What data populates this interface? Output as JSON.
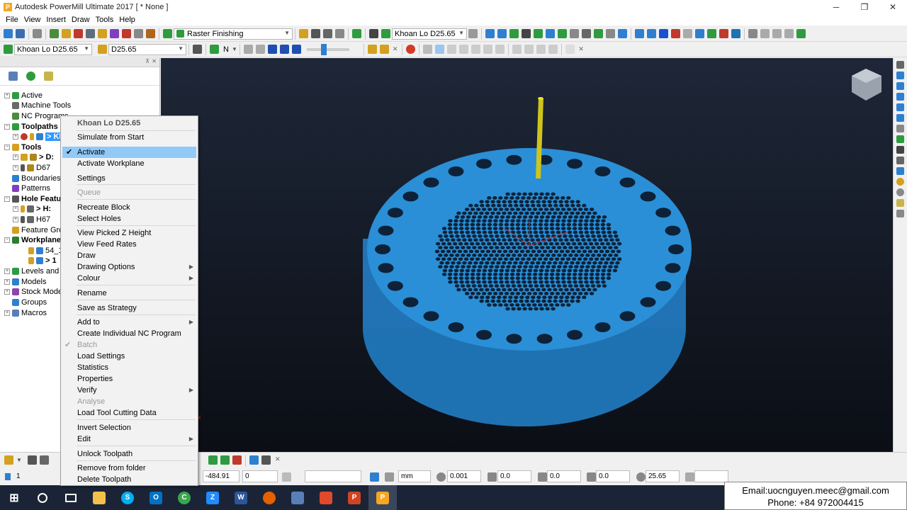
{
  "window": {
    "title": "Autodesk PowerMill Ultimate 2017   [ * None ]",
    "controls": [
      "─",
      "❐",
      "✕"
    ]
  },
  "menubar": [
    "File",
    "View",
    "Insert",
    "Draw",
    "Tools",
    "Help"
  ],
  "toolbar1": {
    "strategy": "Raster Finishing",
    "toolpath": "Khoan Lo D25.65"
  },
  "toolbar2": {
    "toolpath": "Khoan Lo D25.65",
    "tool": "D25.65",
    "workplane": "N"
  },
  "tree": {
    "items": [
      {
        "label": "Active",
        "bold": false
      },
      {
        "label": "Machine Tools",
        "bold": false
      },
      {
        "label": "NC Programs",
        "bold": false
      },
      {
        "label": "Toolpaths",
        "bold": true
      },
      {
        "label": "> Kl",
        "bold": true
      },
      {
        "label": "Tools",
        "bold": true
      },
      {
        "label": "> D:",
        "bold": true
      },
      {
        "label": "D67",
        "bold": false
      },
      {
        "label": "Boundaries",
        "bold": false
      },
      {
        "label": "Patterns",
        "bold": false
      },
      {
        "label": "Hole Featur",
        "bold": true
      },
      {
        "label": "> H:",
        "bold": true
      },
      {
        "label": "H67",
        "bold": false
      },
      {
        "label": "Feature Grou",
        "bold": false
      },
      {
        "label": "Workplanes",
        "bold": true
      },
      {
        "label": "54_1",
        "bold": false
      },
      {
        "label": "> 1",
        "bold": true
      },
      {
        "label": "Levels and S",
        "bold": false
      },
      {
        "label": "Models",
        "bold": false
      },
      {
        "label": "Stock Mode",
        "bold": false
      },
      {
        "label": "Groups",
        "bold": false
      },
      {
        "label": "Macros",
        "bold": false
      }
    ]
  },
  "context_menu": {
    "header": "Khoan Lo D25.65",
    "items": [
      {
        "label": "Simulate from Start"
      },
      {
        "label": "Activate",
        "checked": true,
        "highlighted": true
      },
      {
        "label": "Activate Workplane"
      },
      {
        "label": "Settings"
      },
      {
        "label": "Queue",
        "disabled": true
      },
      {
        "label": "Recreate Block"
      },
      {
        "label": "Select Holes"
      },
      {
        "label": "View Picked Z Height"
      },
      {
        "label": "View Feed Rates"
      },
      {
        "label": "Draw"
      },
      {
        "label": "Drawing Options",
        "submenu": true
      },
      {
        "label": "Colour",
        "submenu": true
      },
      {
        "label": "Rename"
      },
      {
        "label": "Save as Strategy"
      },
      {
        "label": "Add to",
        "submenu": true
      },
      {
        "label": "Create Individual NC Program"
      },
      {
        "label": "Batch",
        "disabled": true,
        "checked_dim": true
      },
      {
        "label": "Load Settings"
      },
      {
        "label": "Statistics"
      },
      {
        "label": "Properties"
      },
      {
        "label": "Verify",
        "submenu": true
      },
      {
        "label": "Analyse",
        "disabled": true
      },
      {
        "label": "Load Tool Cutting Data"
      },
      {
        "label": "Invert Selection"
      },
      {
        "label": "Edit",
        "submenu": true
      },
      {
        "label": "Unlock Toolpath"
      },
      {
        "label": "Remove from folder"
      },
      {
        "label": "Delete Toolpath"
      }
    ]
  },
  "statusbar": {
    "left_value": "1",
    "x": "-484.91",
    "y": "0",
    "units": "mm",
    "tolerance": "0.001",
    "thickness": "0.0",
    "stepover": "0.0",
    "other": "0.0",
    "diameter": "25.65"
  },
  "contact": {
    "email": "Email:uocnguyen.meec@gmail.com",
    "phone": "Phone: +84 972004415"
  },
  "colors": {
    "part": "#2a8fd6",
    "part_dark": "#1f72b2",
    "tool": "#cfc41a",
    "viewport_top": "#1e2738",
    "highlight": "#91c9f7"
  },
  "taskbar_apps": [
    "windows-start",
    "cortana",
    "task-view",
    "file-explorer",
    "skype",
    "outlook",
    "camtasia",
    "zalo",
    "word",
    "firefox",
    "window",
    "filmora",
    "powerpoint",
    "powermill"
  ]
}
